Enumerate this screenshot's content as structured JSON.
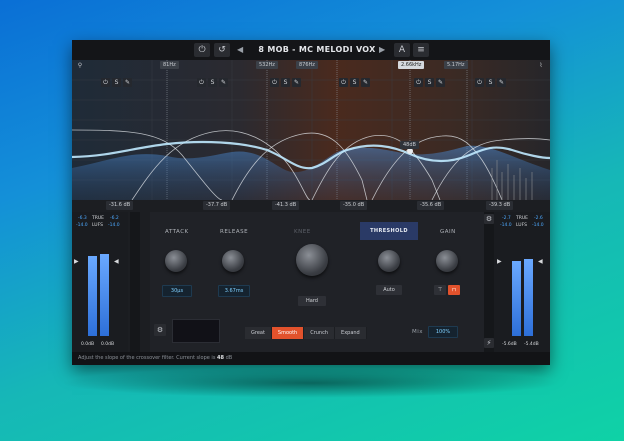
{
  "header": {
    "preset_name": "8 MOB - MC MELODI VOX",
    "power_icon": "⏻",
    "undo_icon": "↺",
    "prev_icon": "◀",
    "next_icon": "▶",
    "ab_label": "A",
    "menu_icon": "≡"
  },
  "eq": {
    "band_freqs": [
      "81Hz",
      "532Hz",
      "876Hz",
      "2.66kHz",
      "5.17Hz"
    ],
    "band_ctl": {
      "power": "⏻",
      "solo": "S",
      "edit": "✎"
    },
    "db_marker": "48dB",
    "thresholds": [
      "-31.6 dB",
      "-37.7 dB",
      "-41.3 dB",
      "-35.0 dB",
      "-35.6 dB",
      "-39.3 dB"
    ]
  },
  "meter_in": {
    "left_peak": "-6.3",
    "true_label": "TRUE",
    "right_peak": "-6.2",
    "left_lufs": "-14.0",
    "lufs_label": "LUFS",
    "right_lufs": "-14.0",
    "left_val": "0.0dB",
    "right_val": "0.0dB",
    "levels": [
      0.8,
      0.82
    ]
  },
  "meter_out": {
    "left_peak": "-2.7",
    "true_label": "TRUE",
    "right_peak": "-2.6",
    "left_lufs": "-14.0",
    "lufs_label": "LUFS",
    "right_lufs": "-14.0",
    "left_val": "-5.6dB",
    "right_val": "-5.4dB",
    "levels": [
      0.75,
      0.77
    ]
  },
  "controls": {
    "attack_label": "ATTACK",
    "attack_value": "30μs",
    "release_label": "RELEASE",
    "release_value": "3.67ms",
    "knee_label": "KNEE",
    "knee_value": "Hard",
    "threshold_label": "THRESHOLD",
    "auto_label": "Auto",
    "gain_label": "GAIN",
    "mix_label": "Mix",
    "mix_value": "100%",
    "modes": [
      "Great",
      "Smooth",
      "Crunch",
      "Expand"
    ],
    "active_mode": "Smooth"
  },
  "status": {
    "text": "Adjust the slope of the crossover filter. Current slope is",
    "slope_value": "48",
    "unit": "dB"
  }
}
